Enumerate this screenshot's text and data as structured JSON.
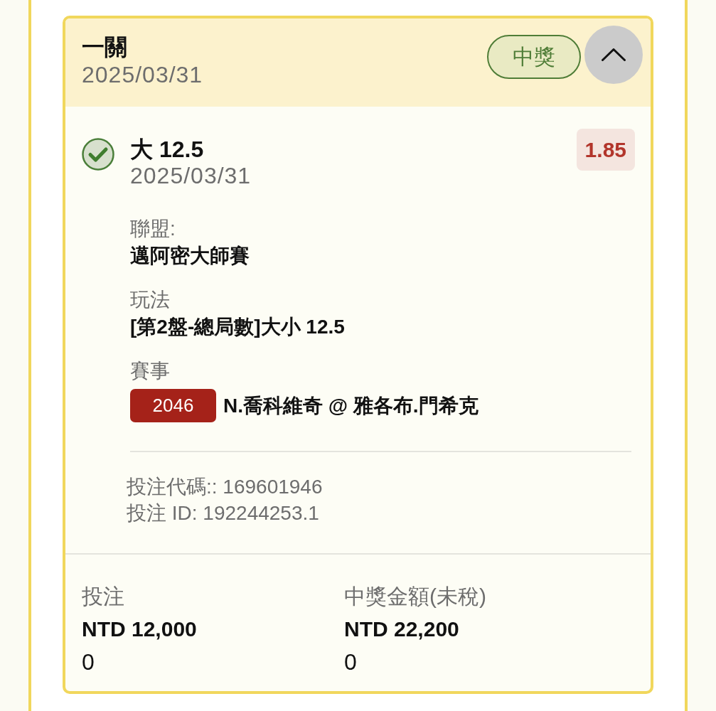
{
  "header": {
    "title": "一關",
    "date": "2025/03/31",
    "status_badge": {
      "label": "中獎",
      "kind": "won"
    },
    "expanded": true
  },
  "selections": [
    {
      "won": true,
      "pick": "大 12.5",
      "date": "2025/03/31",
      "odds": "1.85",
      "details": [
        {
          "kind": "text",
          "label": "聯盟:",
          "value": "邁阿密大師賽"
        },
        {
          "kind": "text",
          "label": "玩法",
          "value": "[第2盤-總局數]大小 12.5"
        },
        {
          "kind": "event",
          "label": "賽事",
          "event_code": "2046",
          "value": "N.喬科維奇 @ 雅各布.門希克"
        }
      ],
      "bet_codes": [
        "投注代碼:: 169601946",
        "投注 ID: 192244253.1"
      ]
    }
  ],
  "summary": [
    {
      "label": "投注",
      "amount": "NTD 12,000",
      "extra": "0"
    },
    {
      "label": "中獎金額(未稅)",
      "amount": "NTD 22,200",
      "extra": "0"
    }
  ]
}
